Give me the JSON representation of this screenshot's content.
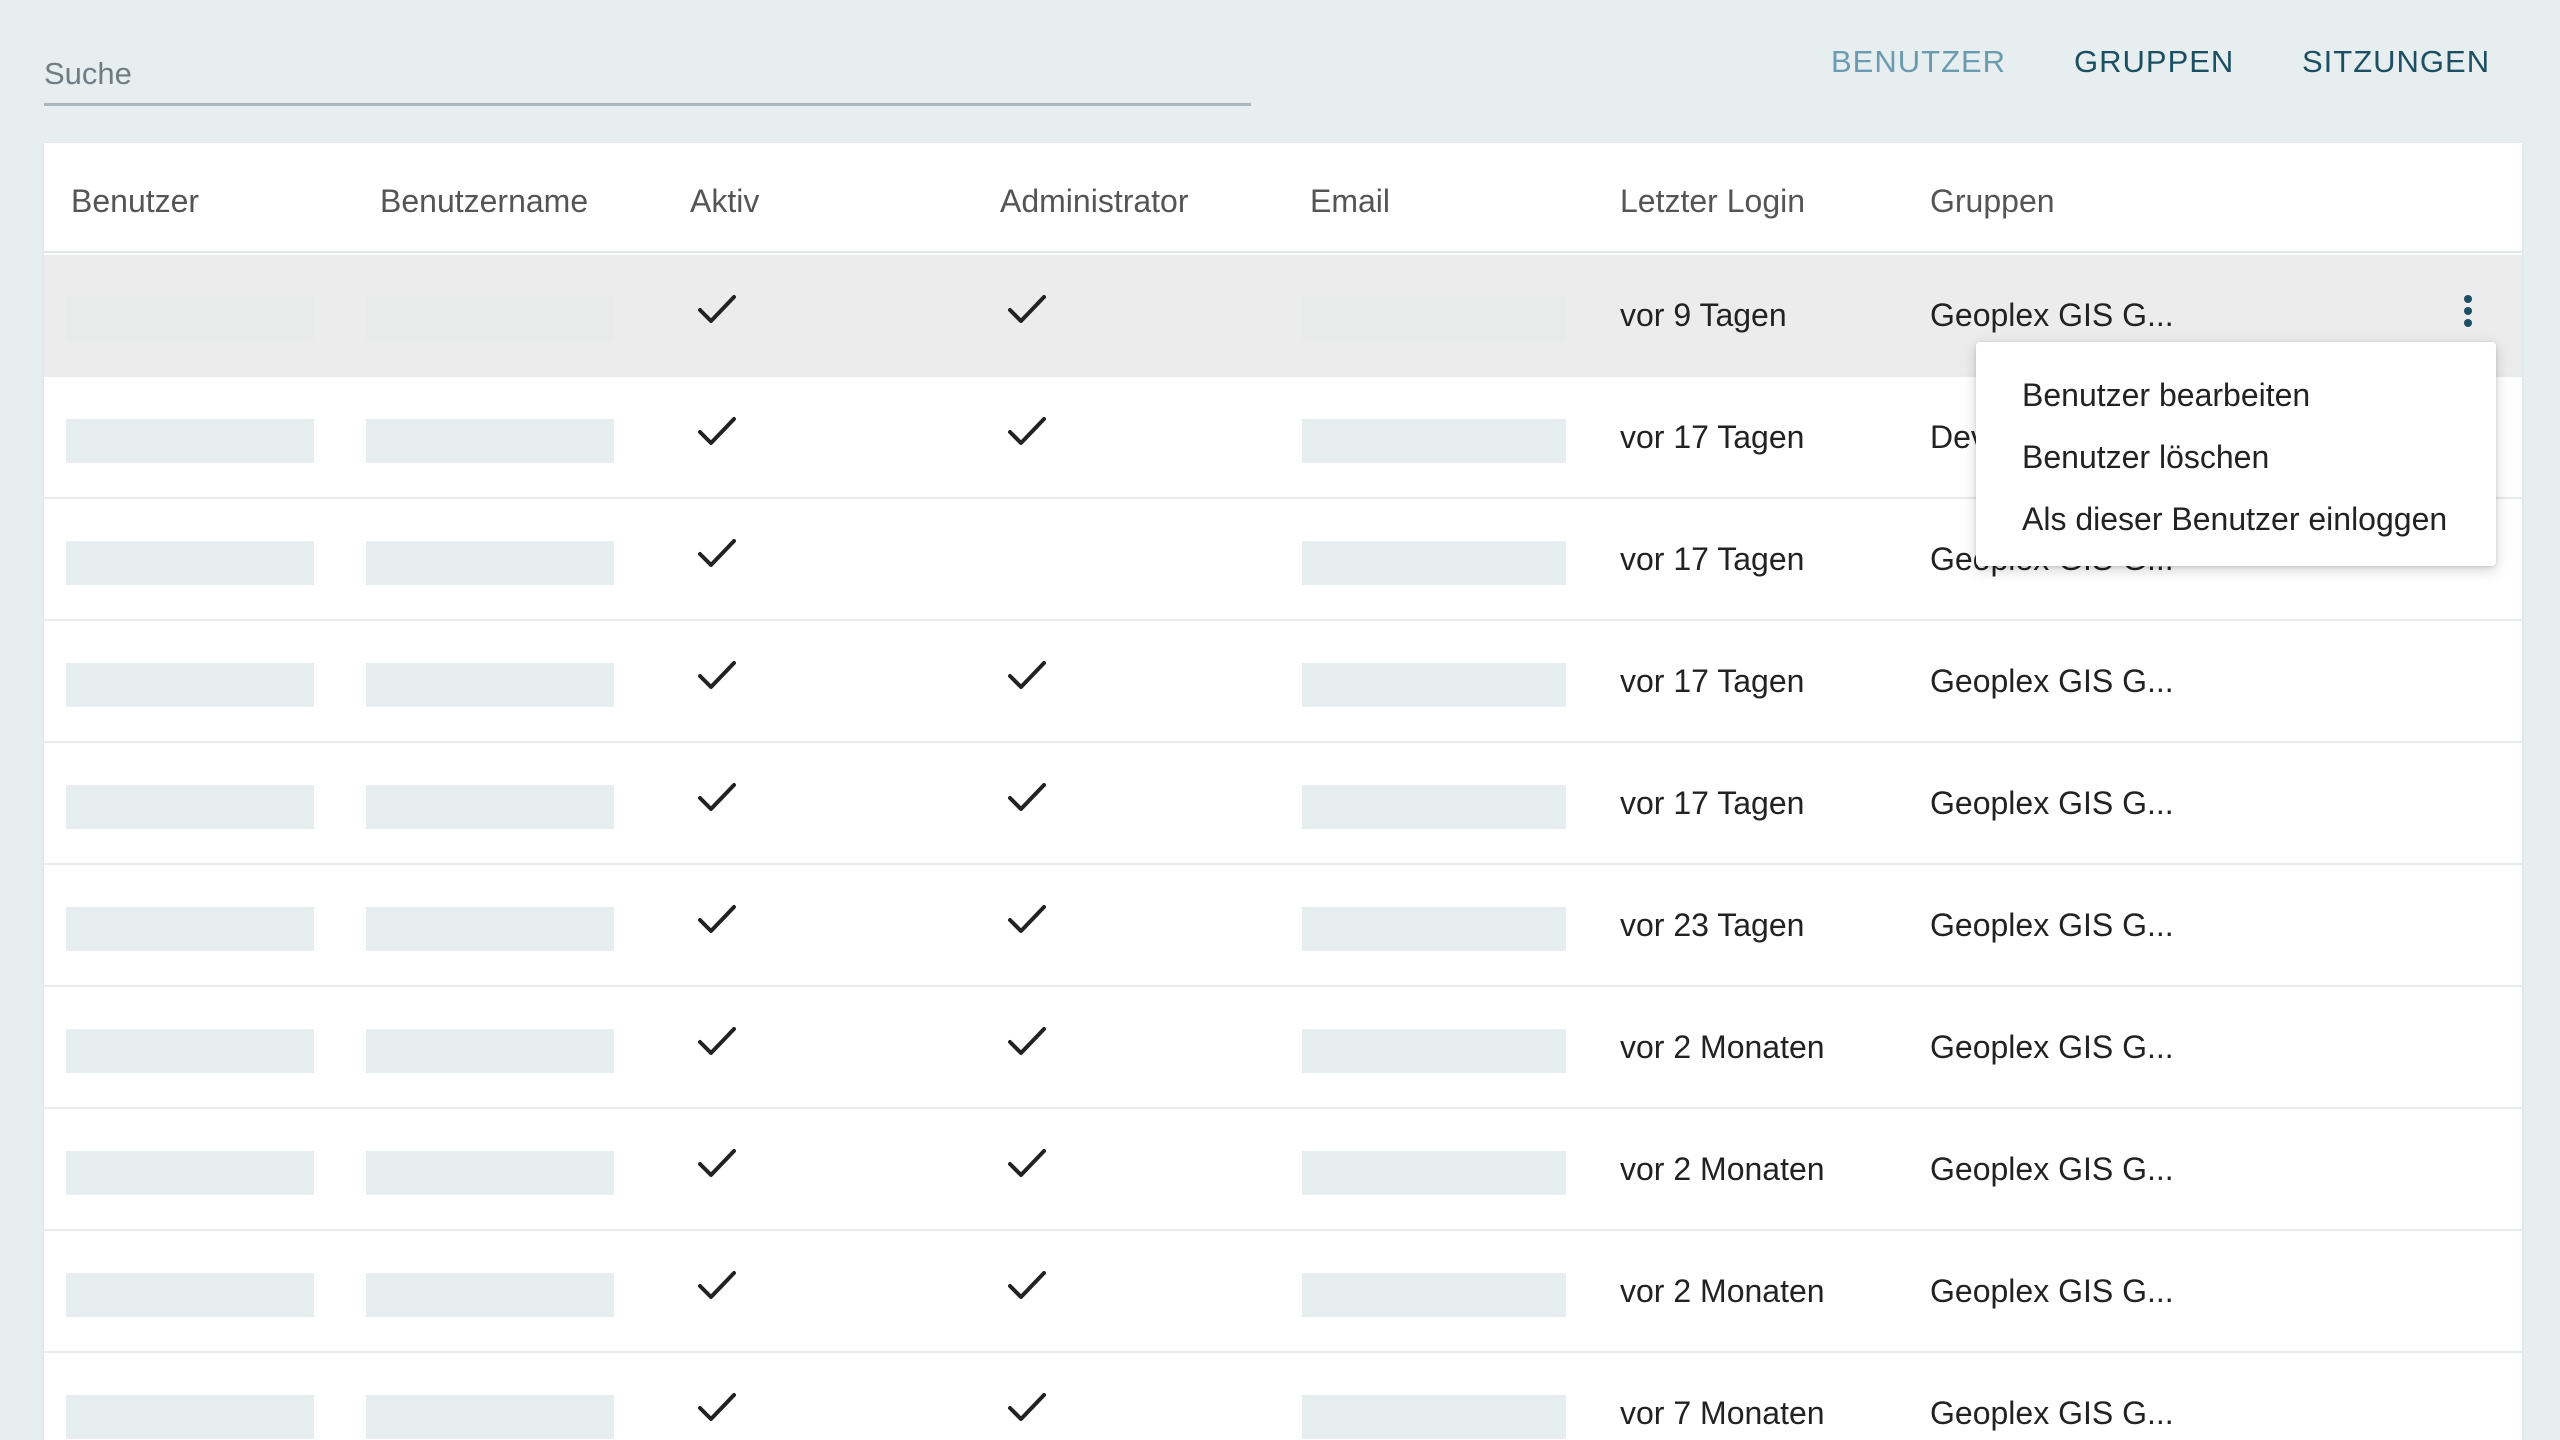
{
  "search": {
    "placeholder": "Suche"
  },
  "nav": {
    "items": [
      "BENUTZER",
      "GRUPPEN",
      "SITZUNGEN"
    ],
    "active": "BENUTZER"
  },
  "table": {
    "headers": [
      "Benutzer",
      "Benutzername",
      "Aktiv",
      "Administrator",
      "Email",
      "Letzter Login",
      "Gruppen"
    ],
    "rows": [
      {
        "aktiv": true,
        "admin": true,
        "last_login": "vor 9 Tagen",
        "gruppen": "Geoplex GIS G..."
      },
      {
        "aktiv": true,
        "admin": true,
        "last_login": "vor 17 Tagen",
        "gruppen": "Dev"
      },
      {
        "aktiv": true,
        "admin": false,
        "last_login": "vor 17 Tagen",
        "gruppen": "Geoplex GIS G..."
      },
      {
        "aktiv": true,
        "admin": true,
        "last_login": "vor 17 Tagen",
        "gruppen": "Geoplex GIS G..."
      },
      {
        "aktiv": true,
        "admin": true,
        "last_login": "vor 17 Tagen",
        "gruppen": "Geoplex GIS G..."
      },
      {
        "aktiv": true,
        "admin": true,
        "last_login": "vor 23 Tagen",
        "gruppen": "Geoplex GIS G..."
      },
      {
        "aktiv": true,
        "admin": true,
        "last_login": "vor 2 Monaten",
        "gruppen": "Geoplex GIS G..."
      },
      {
        "aktiv": true,
        "admin": true,
        "last_login": "vor 2 Monaten",
        "gruppen": "Geoplex GIS G..."
      },
      {
        "aktiv": true,
        "admin": true,
        "last_login": "vor 2 Monaten",
        "gruppen": "Geoplex GIS G..."
      },
      {
        "aktiv": true,
        "admin": true,
        "last_login": "vor 7 Monaten",
        "gruppen": "Geoplex GIS G..."
      }
    ]
  },
  "row_menu": {
    "items": [
      "Benutzer bearbeiten",
      "Benutzer löschen",
      "Als dieser Benutzer einloggen"
    ]
  },
  "colors": {
    "background": "#e7eef0",
    "nav_link": "#1d4f63",
    "nav_active": "#6b9bb0",
    "placeholder_block": "#e7eef0"
  },
  "icons": {
    "row_action": "more-vertical-icon",
    "boolean_true": "check-icon"
  }
}
